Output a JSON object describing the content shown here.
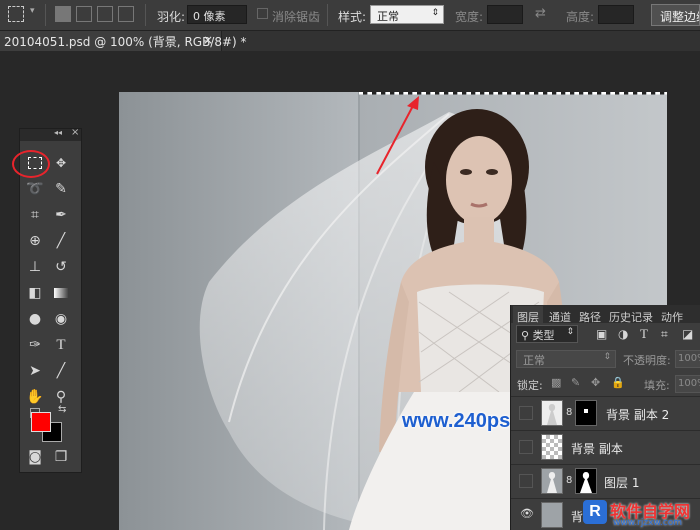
{
  "options_bar": {
    "feather_label": "羽化:",
    "feather_value": "0 像素",
    "antialias_label": "消除锯齿",
    "style_label": "样式:",
    "style_value": "正常",
    "width_label": "宽度:",
    "height_label": "高度:",
    "refine_edge_button": "调整边缘"
  },
  "document_tab": {
    "title": "20104051.psd @ 100% (背景, RGB/8#) *",
    "close_glyph": "×"
  },
  "toolbox": {
    "collapse_glyph": "◂◂",
    "close_glyph": "×",
    "foreground_color": "#ff0000",
    "background_color": "#000000"
  },
  "canvas": {
    "watermark": "www.240ps.com",
    "annotation_color": "#e8242c"
  },
  "layers_panel": {
    "tabs": [
      "图层",
      "通道",
      "路径",
      "历史记录",
      "动作"
    ],
    "filter_kind": "类型",
    "blend_mode": "正常",
    "opacity_label": "不透明度:",
    "opacity_value": "100%",
    "lock_label": "锁定:",
    "fill_label": "填充:",
    "fill_value": "100%",
    "layers": [
      {
        "name": "背景 副本 2"
      },
      {
        "name": "背景 副本"
      },
      {
        "name": "图层 1"
      },
      {
        "name": "背景"
      }
    ]
  },
  "corner_logo": {
    "title": "软件自学网",
    "url": "www.rjzxw.com"
  }
}
